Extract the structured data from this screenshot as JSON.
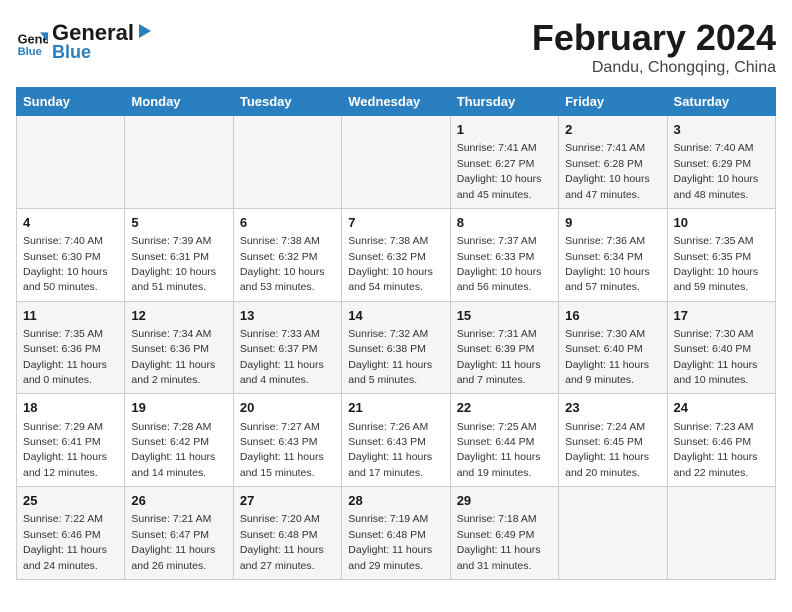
{
  "header": {
    "logo_line1": "General",
    "logo_line2": "Blue",
    "main_title": "February 2024",
    "subtitle": "Dandu, Chongqing, China"
  },
  "days_of_week": [
    "Sunday",
    "Monday",
    "Tuesday",
    "Wednesday",
    "Thursday",
    "Friday",
    "Saturday"
  ],
  "weeks": [
    [
      {
        "day": "",
        "detail": ""
      },
      {
        "day": "",
        "detail": ""
      },
      {
        "day": "",
        "detail": ""
      },
      {
        "day": "",
        "detail": ""
      },
      {
        "day": "1",
        "detail": "Sunrise: 7:41 AM\nSunset: 6:27 PM\nDaylight: 10 hours\nand 45 minutes."
      },
      {
        "day": "2",
        "detail": "Sunrise: 7:41 AM\nSunset: 6:28 PM\nDaylight: 10 hours\nand 47 minutes."
      },
      {
        "day": "3",
        "detail": "Sunrise: 7:40 AM\nSunset: 6:29 PM\nDaylight: 10 hours\nand 48 minutes."
      }
    ],
    [
      {
        "day": "4",
        "detail": "Sunrise: 7:40 AM\nSunset: 6:30 PM\nDaylight: 10 hours\nand 50 minutes."
      },
      {
        "day": "5",
        "detail": "Sunrise: 7:39 AM\nSunset: 6:31 PM\nDaylight: 10 hours\nand 51 minutes."
      },
      {
        "day": "6",
        "detail": "Sunrise: 7:38 AM\nSunset: 6:32 PM\nDaylight: 10 hours\nand 53 minutes."
      },
      {
        "day": "7",
        "detail": "Sunrise: 7:38 AM\nSunset: 6:32 PM\nDaylight: 10 hours\nand 54 minutes."
      },
      {
        "day": "8",
        "detail": "Sunrise: 7:37 AM\nSunset: 6:33 PM\nDaylight: 10 hours\nand 56 minutes."
      },
      {
        "day": "9",
        "detail": "Sunrise: 7:36 AM\nSunset: 6:34 PM\nDaylight: 10 hours\nand 57 minutes."
      },
      {
        "day": "10",
        "detail": "Sunrise: 7:35 AM\nSunset: 6:35 PM\nDaylight: 10 hours\nand 59 minutes."
      }
    ],
    [
      {
        "day": "11",
        "detail": "Sunrise: 7:35 AM\nSunset: 6:36 PM\nDaylight: 11 hours\nand 0 minutes."
      },
      {
        "day": "12",
        "detail": "Sunrise: 7:34 AM\nSunset: 6:36 PM\nDaylight: 11 hours\nand 2 minutes."
      },
      {
        "day": "13",
        "detail": "Sunrise: 7:33 AM\nSunset: 6:37 PM\nDaylight: 11 hours\nand 4 minutes."
      },
      {
        "day": "14",
        "detail": "Sunrise: 7:32 AM\nSunset: 6:38 PM\nDaylight: 11 hours\nand 5 minutes."
      },
      {
        "day": "15",
        "detail": "Sunrise: 7:31 AM\nSunset: 6:39 PM\nDaylight: 11 hours\nand 7 minutes."
      },
      {
        "day": "16",
        "detail": "Sunrise: 7:30 AM\nSunset: 6:40 PM\nDaylight: 11 hours\nand 9 minutes."
      },
      {
        "day": "17",
        "detail": "Sunrise: 7:30 AM\nSunset: 6:40 PM\nDaylight: 11 hours\nand 10 minutes."
      }
    ],
    [
      {
        "day": "18",
        "detail": "Sunrise: 7:29 AM\nSunset: 6:41 PM\nDaylight: 11 hours\nand 12 minutes."
      },
      {
        "day": "19",
        "detail": "Sunrise: 7:28 AM\nSunset: 6:42 PM\nDaylight: 11 hours\nand 14 minutes."
      },
      {
        "day": "20",
        "detail": "Sunrise: 7:27 AM\nSunset: 6:43 PM\nDaylight: 11 hours\nand 15 minutes."
      },
      {
        "day": "21",
        "detail": "Sunrise: 7:26 AM\nSunset: 6:43 PM\nDaylight: 11 hours\nand 17 minutes."
      },
      {
        "day": "22",
        "detail": "Sunrise: 7:25 AM\nSunset: 6:44 PM\nDaylight: 11 hours\nand 19 minutes."
      },
      {
        "day": "23",
        "detail": "Sunrise: 7:24 AM\nSunset: 6:45 PM\nDaylight: 11 hours\nand 20 minutes."
      },
      {
        "day": "24",
        "detail": "Sunrise: 7:23 AM\nSunset: 6:46 PM\nDaylight: 11 hours\nand 22 minutes."
      }
    ],
    [
      {
        "day": "25",
        "detail": "Sunrise: 7:22 AM\nSunset: 6:46 PM\nDaylight: 11 hours\nand 24 minutes."
      },
      {
        "day": "26",
        "detail": "Sunrise: 7:21 AM\nSunset: 6:47 PM\nDaylight: 11 hours\nand 26 minutes."
      },
      {
        "day": "27",
        "detail": "Sunrise: 7:20 AM\nSunset: 6:48 PM\nDaylight: 11 hours\nand 27 minutes."
      },
      {
        "day": "28",
        "detail": "Sunrise: 7:19 AM\nSunset: 6:48 PM\nDaylight: 11 hours\nand 29 minutes."
      },
      {
        "day": "29",
        "detail": "Sunrise: 7:18 AM\nSunset: 6:49 PM\nDaylight: 11 hours\nand 31 minutes."
      },
      {
        "day": "",
        "detail": ""
      },
      {
        "day": "",
        "detail": ""
      }
    ]
  ]
}
